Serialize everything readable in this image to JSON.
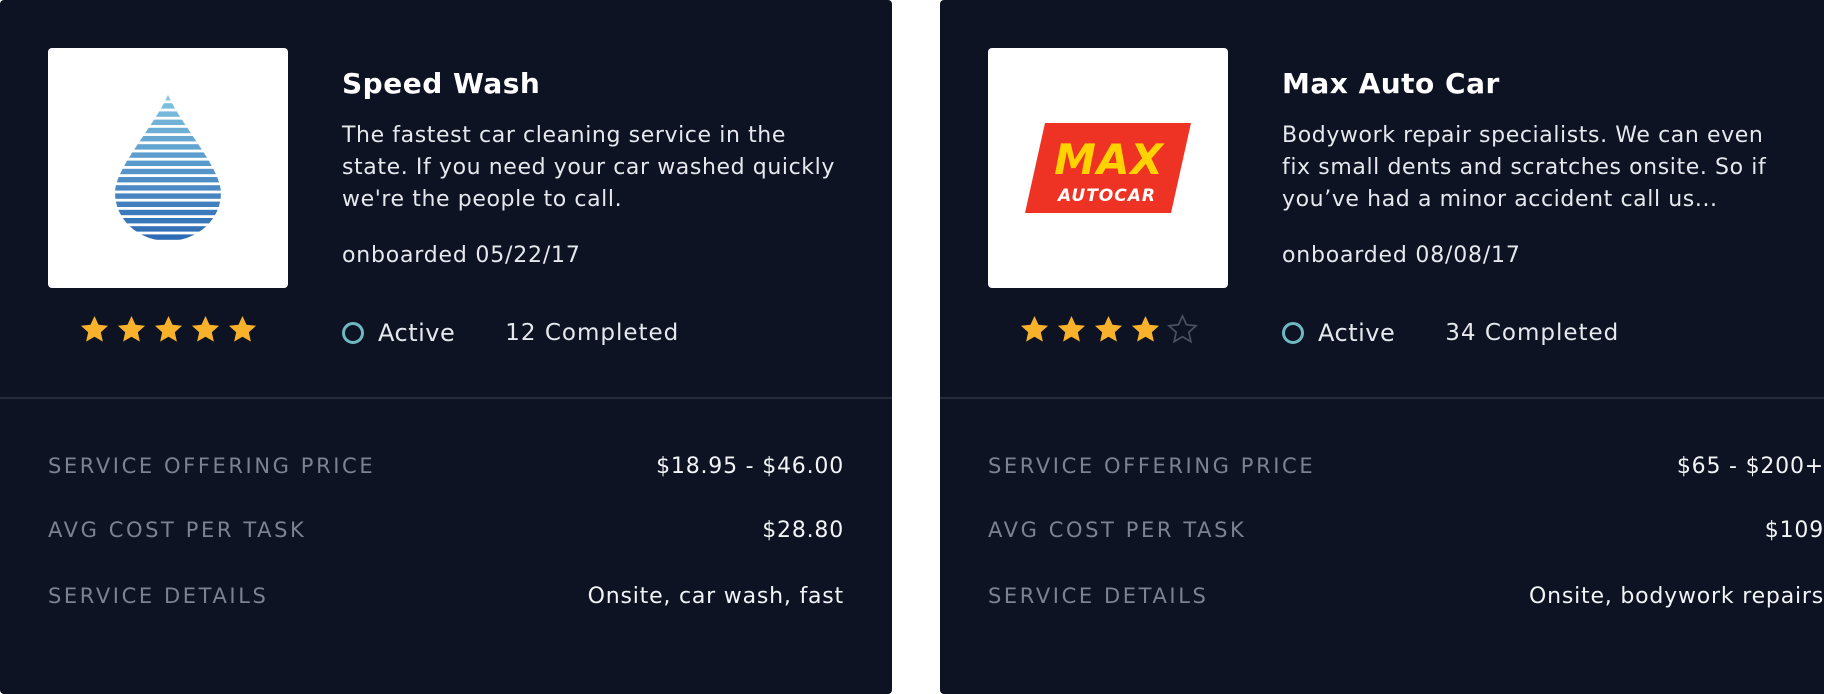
{
  "cards": [
    {
      "logo_icon": "water-drop-icon",
      "rating": 5,
      "rating_max": 5,
      "title": "Speed Wash",
      "description": "The fastest car cleaning service in the state. If you need your car washed quickly we're the people to call.",
      "onboarded": "onboarded 05/22/17",
      "status": "Active",
      "completed": "12 Completed",
      "details": [
        {
          "label": "SERVICE OFFERING PRICE",
          "value": "$18.95 - $46.00"
        },
        {
          "label": "AVG COST PER TASK",
          "value": "$28.80"
        },
        {
          "label": "SERVICE DETAILS",
          "value": "Onsite, car wash, fast"
        }
      ]
    },
    {
      "logo_icon": "max-autocar-logo",
      "logo_text_top": "MAX",
      "logo_text_bottom": "AUTOCAR",
      "rating": 4,
      "rating_max": 5,
      "title": "Max Auto Car",
      "description": "Bodywork repair specialists. We can even fix small dents and scratches onsite. So if you’ve had a minor accident call us...",
      "onboarded": "onboarded 08/08/17",
      "status": "Active",
      "completed": "34 Completed",
      "details": [
        {
          "label": "SERVICE OFFERING PRICE",
          "value": "$65 - $200+"
        },
        {
          "label": "AVG COST PER TASK",
          "value": "$109"
        },
        {
          "label": "SERVICE DETAILS",
          "value": "Onsite, bodywork repairs"
        }
      ]
    }
  ],
  "colors": {
    "card_bg": "#0d1322",
    "star_filled": "#f7b12b",
    "star_empty": "#4a5162",
    "status_ring": "#6fb8c2",
    "label": "#7b8293",
    "logo_red": "#ee3224",
    "logo_yellow": "#ffd200"
  }
}
